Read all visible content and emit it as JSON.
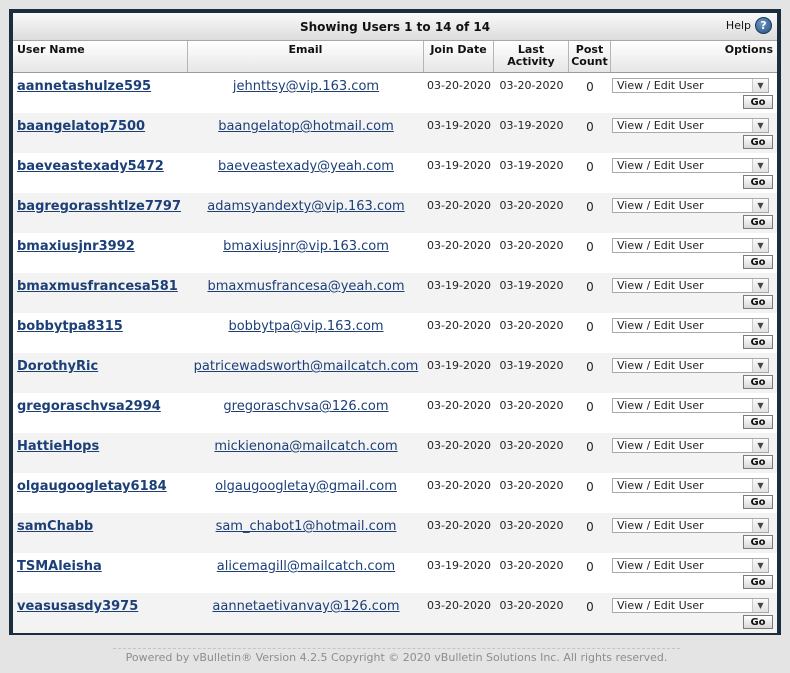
{
  "title_bar": {
    "text": "Showing Users 1 to 14 of 14",
    "help_label": "Help",
    "help_icon": "?"
  },
  "columns": {
    "user_name": "User Name",
    "email": "Email",
    "join_date": "Join Date",
    "last_activity_1": "Last",
    "last_activity_2": "Activity",
    "post_count_1": "Post",
    "post_count_2": "Count",
    "options": "Options"
  },
  "select_default": "View / Edit User",
  "go_label": "Go",
  "users": [
    {
      "name": "aannetashulze595",
      "email": "jehnttsy@vip.163.com",
      "join": "03-20-2020",
      "last": "03-20-2020",
      "posts": "0"
    },
    {
      "name": "baangelatop7500",
      "email": "baangelatop@hotmail.com",
      "join": "03-19-2020",
      "last": "03-19-2020",
      "posts": "0"
    },
    {
      "name": "baeveastexady5472",
      "email": "baeveastexady@yeah.com",
      "join": "03-19-2020",
      "last": "03-19-2020",
      "posts": "0"
    },
    {
      "name": "bagregorasshtlze7797",
      "email": "adamsyandexty@vip.163.com",
      "join": "03-20-2020",
      "last": "03-20-2020",
      "posts": "0"
    },
    {
      "name": "bmaxiusjnr3992",
      "email": "bmaxiusjnr@vip.163.com",
      "join": "03-20-2020",
      "last": "03-20-2020",
      "posts": "0"
    },
    {
      "name": "bmaxmusfrancesa581",
      "email": "bmaxmusfrancesa@yeah.com",
      "join": "03-19-2020",
      "last": "03-19-2020",
      "posts": "0"
    },
    {
      "name": "bobbytpa8315",
      "email": "bobbytpa@vip.163.com",
      "join": "03-20-2020",
      "last": "03-20-2020",
      "posts": "0"
    },
    {
      "name": "DorothyRic",
      "email": "patricewadsworth@mailcatch.com",
      "join": "03-19-2020",
      "last": "03-19-2020",
      "posts": "0"
    },
    {
      "name": "gregoraschvsa2994",
      "email": "gregoraschvsa@126.com",
      "join": "03-20-2020",
      "last": "03-20-2020",
      "posts": "0"
    },
    {
      "name": "HattieHops",
      "email": "mickienona@mailcatch.com",
      "join": "03-20-2020",
      "last": "03-20-2020",
      "posts": "0"
    },
    {
      "name": "olgaugoogletay6184",
      "email": "olgaugoogletay@gmail.com",
      "join": "03-20-2020",
      "last": "03-20-2020",
      "posts": "0"
    },
    {
      "name": "samChabb",
      "email": "sam_chabot1@hotmail.com",
      "join": "03-20-2020",
      "last": "03-20-2020",
      "posts": "0"
    },
    {
      "name": "TSMAleisha",
      "email": "alicemagill@mailcatch.com",
      "join": "03-19-2020",
      "last": "03-20-2020",
      "posts": "0"
    },
    {
      "name": "veasusasdy3975",
      "email": "aannetaetivanvay@126.com",
      "join": "03-20-2020",
      "last": "03-20-2020",
      "posts": "0"
    }
  ],
  "footer": {
    "text": "Powered by vBulletin® Version 4.2.5 Copyright © 2020 vBulletin Solutions Inc. All rights reserved."
  },
  "colors": {
    "frame": "#1c2e3d",
    "link": "#1c3f77",
    "alt_row": "#f3f3f3",
    "help_icon": "#28507e"
  }
}
